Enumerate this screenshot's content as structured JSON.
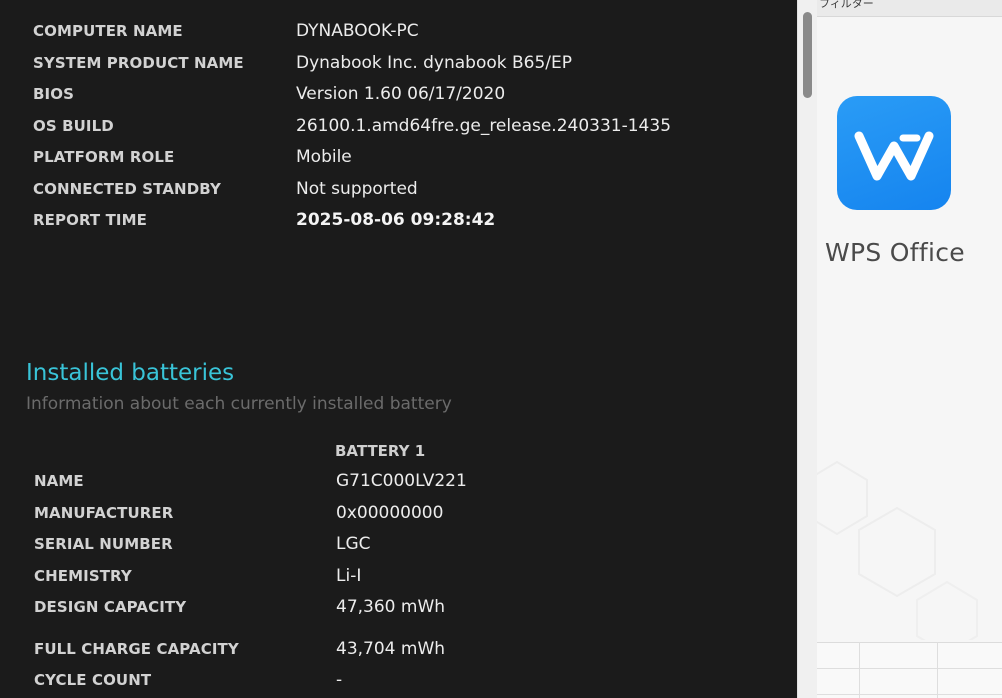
{
  "system_info": [
    {
      "label": "COMPUTER NAME",
      "value": "DYNABOOK-PC"
    },
    {
      "label": "SYSTEM PRODUCT NAME",
      "value": "Dynabook Inc. dynabook B65/EP"
    },
    {
      "label": "BIOS",
      "value": "Version 1.60 06/17/2020"
    },
    {
      "label": "OS BUILD",
      "value": "26100.1.amd64fre.ge_release.240331-1435"
    },
    {
      "label": "PLATFORM ROLE",
      "value": "Mobile"
    },
    {
      "label": "CONNECTED STANDBY",
      "value": "Not supported"
    },
    {
      "label": "REPORT TIME",
      "value": "2025-08-06  09:28:42"
    }
  ],
  "installed_batteries": {
    "title": "Installed batteries",
    "subtitle": "Information about each currently installed battery",
    "column_header": "BATTERY 1",
    "rows": [
      {
        "label": "NAME",
        "value": "G71C000LV221"
      },
      {
        "label": "MANUFACTURER",
        "value": "0x00000000"
      },
      {
        "label": "SERIAL NUMBER",
        "value": "LGC"
      },
      {
        "label": "CHEMISTRY",
        "value": "Li-I"
      },
      {
        "label": "DESIGN CAPACITY",
        "value": "47,360 mWh"
      },
      {
        "label": "FULL CHARGE CAPACITY",
        "value": "43,704 mWh"
      },
      {
        "label": "CYCLE COUNT",
        "value": "-"
      }
    ]
  },
  "wps_panel": {
    "topbar_text": "フィルター",
    "app_name": "WPS Office",
    "logo_icon": "wps-office-logo-icon",
    "brand_color": "#1f8ff2"
  },
  "colors": {
    "report_background": "#1b1b1b",
    "section_title": "#39c4d8",
    "subtitle": "#6b6b6b"
  }
}
